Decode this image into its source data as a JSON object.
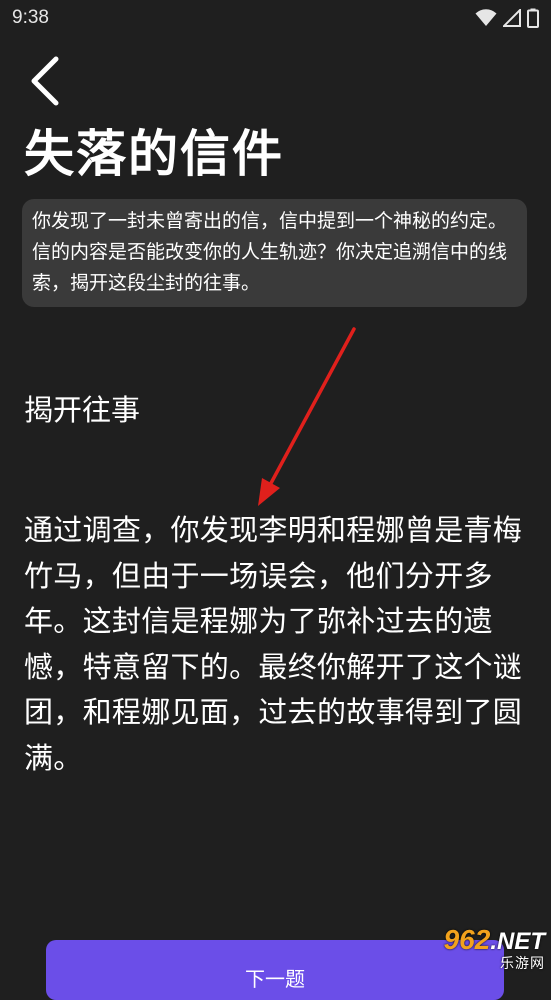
{
  "status_bar": {
    "time": "9:38",
    "icons": [
      "wifi-icon",
      "signal-icon",
      "battery-icon"
    ]
  },
  "header": {
    "back_icon": "chevron-left-icon",
    "title": "失落的信件"
  },
  "description": "你发现了一封未曾寄出的信，信中提到一个神秘的约定。信的内容是否能改变你的人生轨迹？你决定追溯信中的线索，揭开这段尘封的往事。",
  "choice_heading": "揭开往事",
  "story": "通过调查，你发现李明和程娜曾是青梅竹马，但由于一场误会，他们分开多年。这封信是程娜为了弥补过去的遗憾，特意留下的。最终你解开了这个谜团，和程娜见面，过去的故事得到了圆满。",
  "next_button_label": "下一题",
  "watermark": {
    "digits": "962",
    "net": ".NET",
    "subtitle": "乐游网"
  },
  "colors": {
    "background": "#1f1f1f",
    "card": "#3a3a3a",
    "accent": "#6b4ee8",
    "arrow": "#e0201c",
    "watermark": "#f2a21c"
  }
}
